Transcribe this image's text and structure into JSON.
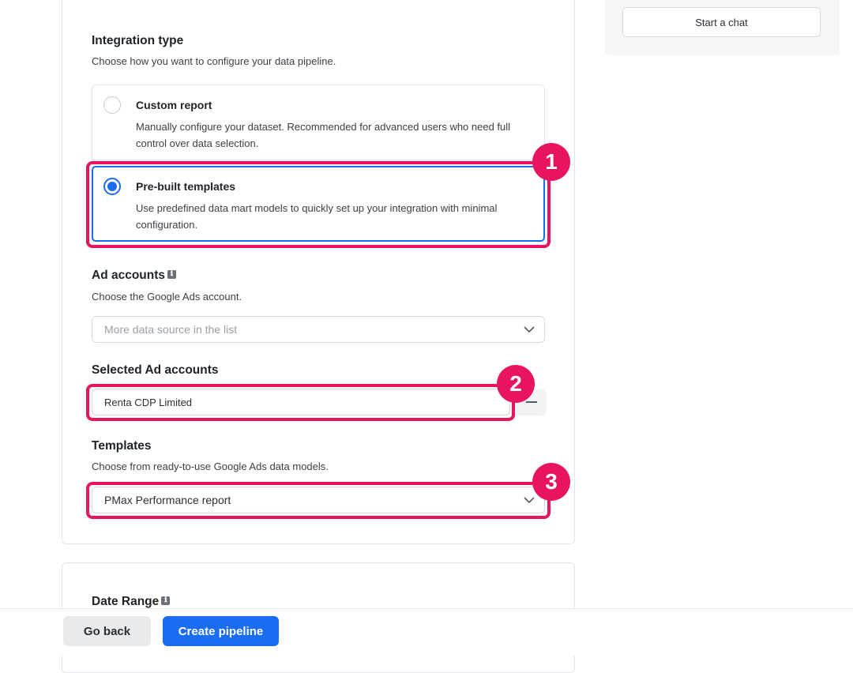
{
  "sidebar": {
    "start_chat_label": "Start a chat"
  },
  "integration_type": {
    "title": "Integration type",
    "description": "Choose how you want to configure your data pipeline.",
    "options": [
      {
        "title": "Custom report",
        "description": "Manually configure your dataset. Recommended for advanced users who need full control over data selection.",
        "selected": false
      },
      {
        "title": "Pre-built templates",
        "description": "Use predefined data mart models to quickly set up your integration with minimal configuration.",
        "selected": true
      }
    ]
  },
  "ad_accounts": {
    "title": "Ad accounts",
    "info_icon": "ℹ",
    "description": "Choose the Google Ads account.",
    "placeholder": "More data source in the list"
  },
  "selected_ad_accounts": {
    "title": "Selected Ad accounts",
    "items": [
      "Renta CDP Limited"
    ]
  },
  "templates": {
    "title": "Templates",
    "description": "Choose from ready-to-use Google Ads data models.",
    "selected_value": "PMax Performance report"
  },
  "date_range": {
    "title": "Date Range",
    "info_icon": "ℹ"
  },
  "footer": {
    "back_label": "Go back",
    "create_label": "Create pipeline"
  },
  "annotations": {
    "badges": [
      "1",
      "2",
      "3"
    ],
    "color": "#e8145f"
  },
  "colors": {
    "accent": "#1a6cf0",
    "annotation": "#e8145f"
  }
}
